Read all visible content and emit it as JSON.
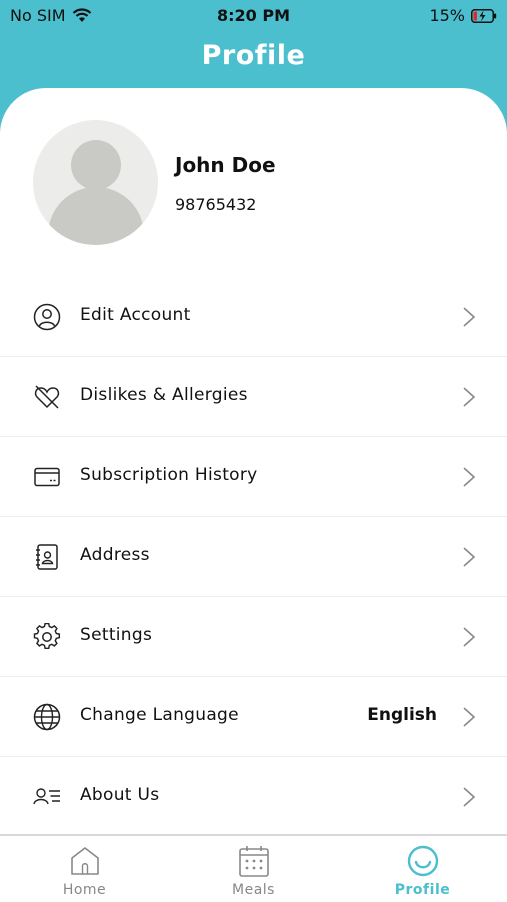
{
  "status_bar": {
    "carrier": "No SIM",
    "time": "8:20 PM",
    "battery": "15%"
  },
  "header": {
    "title": "Profile"
  },
  "profile": {
    "name": "John Doe",
    "phone": "98765432"
  },
  "menu": [
    {
      "label": "Edit Account",
      "icon": "user-circle-icon"
    },
    {
      "label": "Dislikes & Allergies",
      "icon": "broken-heart-icon"
    },
    {
      "label": "Subscription History",
      "icon": "credit-card-icon"
    },
    {
      "label": "Address",
      "icon": "address-book-icon"
    },
    {
      "label": "Settings",
      "icon": "gear-icon"
    },
    {
      "label": "Change Language",
      "value": "English",
      "icon": "globe-icon"
    },
    {
      "label": "About Us",
      "icon": "user-list-icon"
    }
  ],
  "tabs": [
    {
      "label": "Home",
      "icon": "home-icon",
      "active": false
    },
    {
      "label": "Meals",
      "icon": "calendar-icon",
      "active": false
    },
    {
      "label": "Profile",
      "icon": "smile-icon",
      "active": true
    }
  ],
  "colors": {
    "accent": "#4bbfce",
    "inactive": "#888888"
  }
}
